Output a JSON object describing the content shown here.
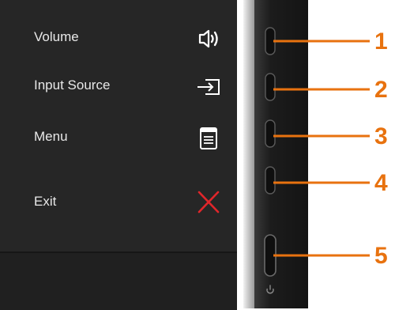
{
  "osd_menu": {
    "items": [
      {
        "label": "Volume",
        "icon": "speaker-icon"
      },
      {
        "label": "Input Source",
        "icon": "input-source-icon"
      },
      {
        "label": "Menu",
        "icon": "menu-document-icon"
      },
      {
        "label": "Exit",
        "icon": "close-x-icon"
      }
    ]
  },
  "callouts": [
    "1",
    "2",
    "3",
    "4",
    "5"
  ],
  "colors": {
    "callout": "#e8720f",
    "exit_icon": "#e0262b",
    "panel": "#262626",
    "text": "#e8e8e8"
  }
}
